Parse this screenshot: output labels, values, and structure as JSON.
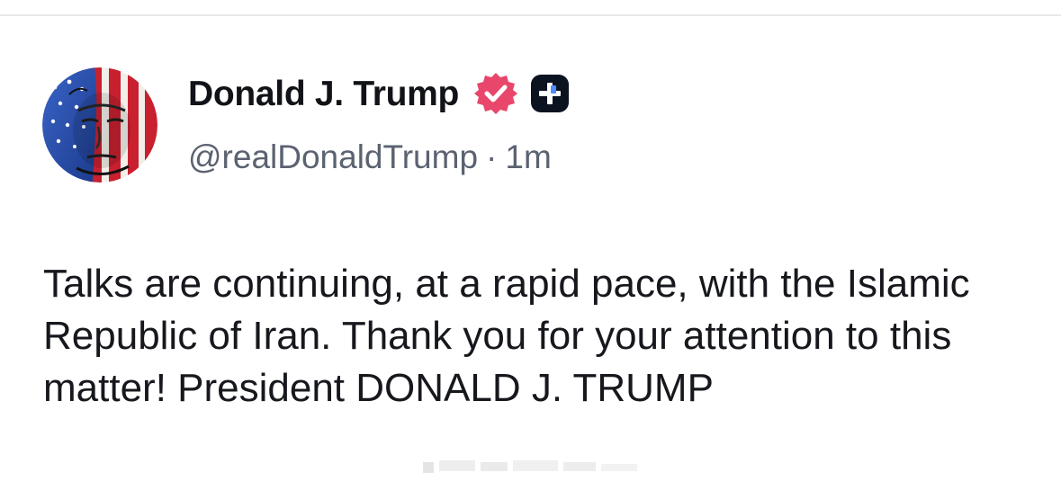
{
  "post": {
    "author": {
      "display_name": "Donald J. Trump",
      "handle": "@realDonaldTrump",
      "avatar_icon": "flag-portrait-avatar",
      "verified_icon": "verified-badge-icon",
      "badge_icon": "plus-badge-icon"
    },
    "separator": "·",
    "time_ago": "1m",
    "text": "Talks are continuing, at a rapid pace, with the Islamic Republic of Iran. Thank you for your attention to this matter! President DONALD J. TRUMP"
  },
  "colors": {
    "verified_badge": "#e8466b",
    "plus_badge": "#0b1220",
    "text_primary": "#111318",
    "text_secondary": "#5b6270"
  }
}
